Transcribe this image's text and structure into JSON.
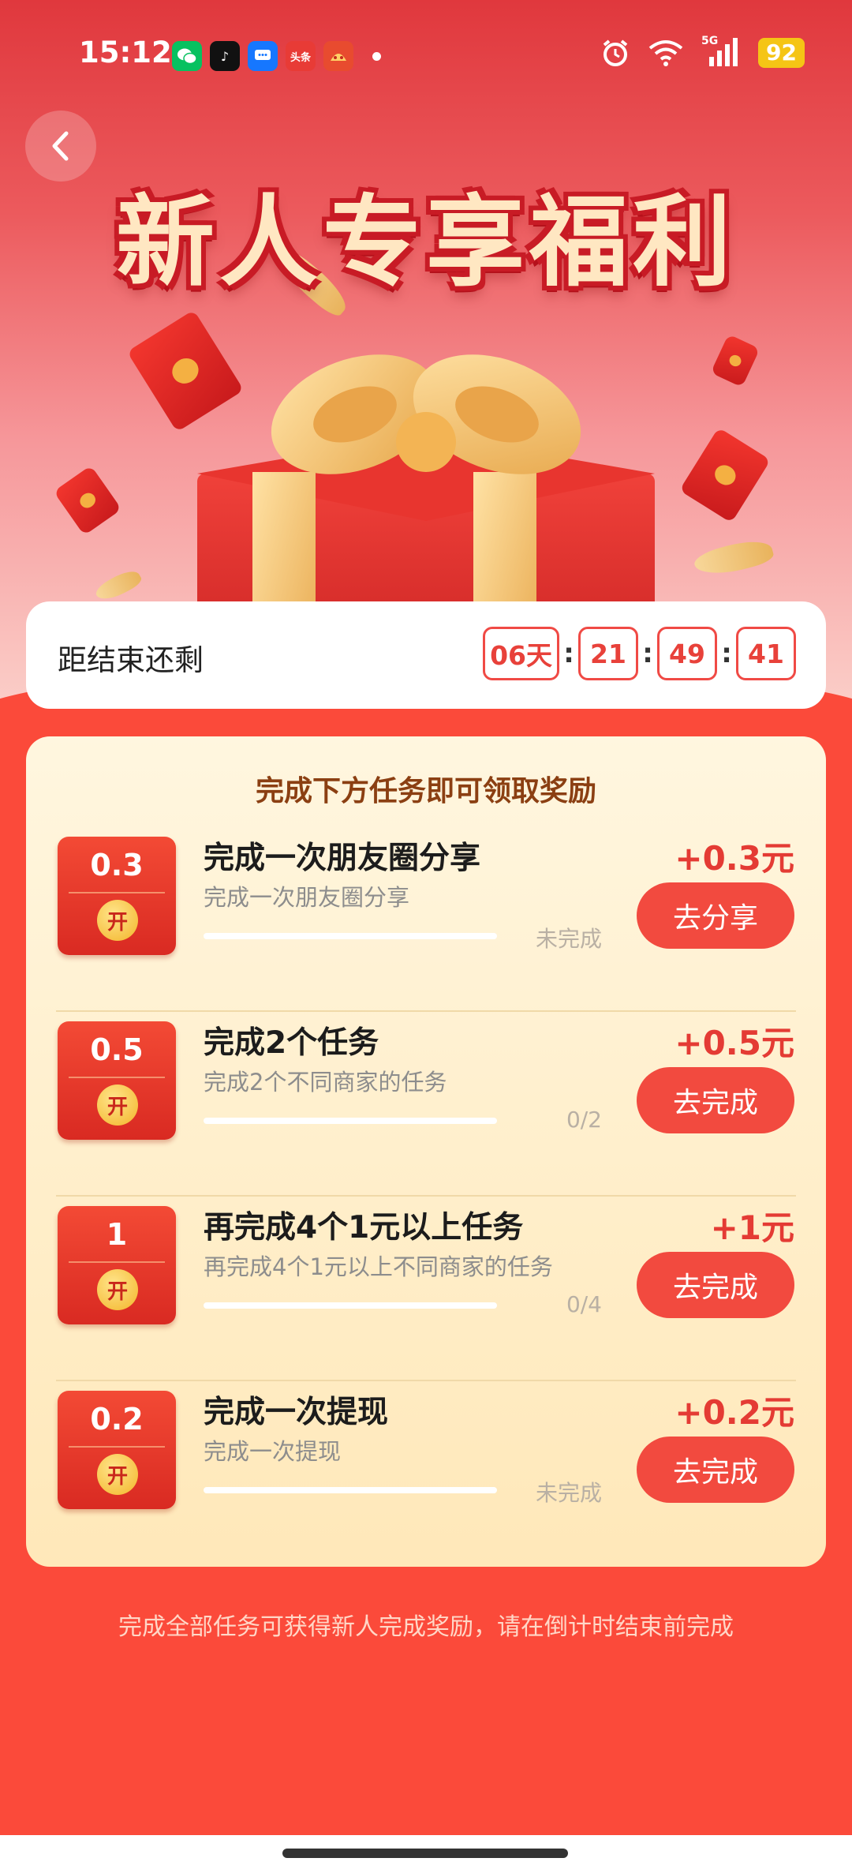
{
  "status_bar": {
    "time": "15:12",
    "apps": [
      {
        "name": "wechat-icon",
        "label": "",
        "color": "#07c160"
      },
      {
        "name": "douyin-icon",
        "label": "♪",
        "color": "#111111"
      },
      {
        "name": "message-icon",
        "label": "",
        "color": "#1677ff"
      },
      {
        "name": "toutiao-icon",
        "label": "头条",
        "color": "#e83b36"
      },
      {
        "name": "app-icon",
        "label": "",
        "color": "#e84b2f"
      }
    ],
    "network": "5G",
    "battery": "92"
  },
  "hero": {
    "title": "新人专享福利"
  },
  "countdown": {
    "label": "距结束还剩",
    "days": "06天",
    "hours": "21",
    "minutes": "49",
    "seconds": "41"
  },
  "tasks_card": {
    "heading": "完成下方任务即可领取奖励",
    "items": [
      {
        "badge_amount": "0.3",
        "badge_open": "开",
        "title": "完成一次朋友圈分享",
        "subtitle": "完成一次朋友圈分享",
        "progress_text": "未完成",
        "progress": 0,
        "reward": "+0.3元",
        "button": "去分享"
      },
      {
        "badge_amount": "0.5",
        "badge_open": "开",
        "title": "完成2个任务",
        "subtitle": "完成2个不同商家的任务",
        "progress_text": "0/2",
        "progress": 0,
        "reward": "+0.5元",
        "button": "去完成"
      },
      {
        "badge_amount": "1",
        "badge_open": "开",
        "title": "再完成4个1元以上任务",
        "subtitle": "再完成4个1元以上不同商家的任务",
        "progress_text": "0/4",
        "progress": 0,
        "reward": "+1元",
        "button": "去完成"
      },
      {
        "badge_amount": "0.2",
        "badge_open": "开",
        "title": "完成一次提现",
        "subtitle": "完成一次提现",
        "progress_text": "未完成",
        "progress": 0,
        "reward": "+0.2元",
        "button": "去完成"
      }
    ]
  },
  "footer_note": "完成全部任务可获得新人完成奖励，请在倒计时结束前完成",
  "colors": {
    "primary_red": "#f24a3f",
    "reward_red": "#e43b34",
    "card_cream": "#fff6df",
    "heading_brown": "#8b3f12"
  }
}
